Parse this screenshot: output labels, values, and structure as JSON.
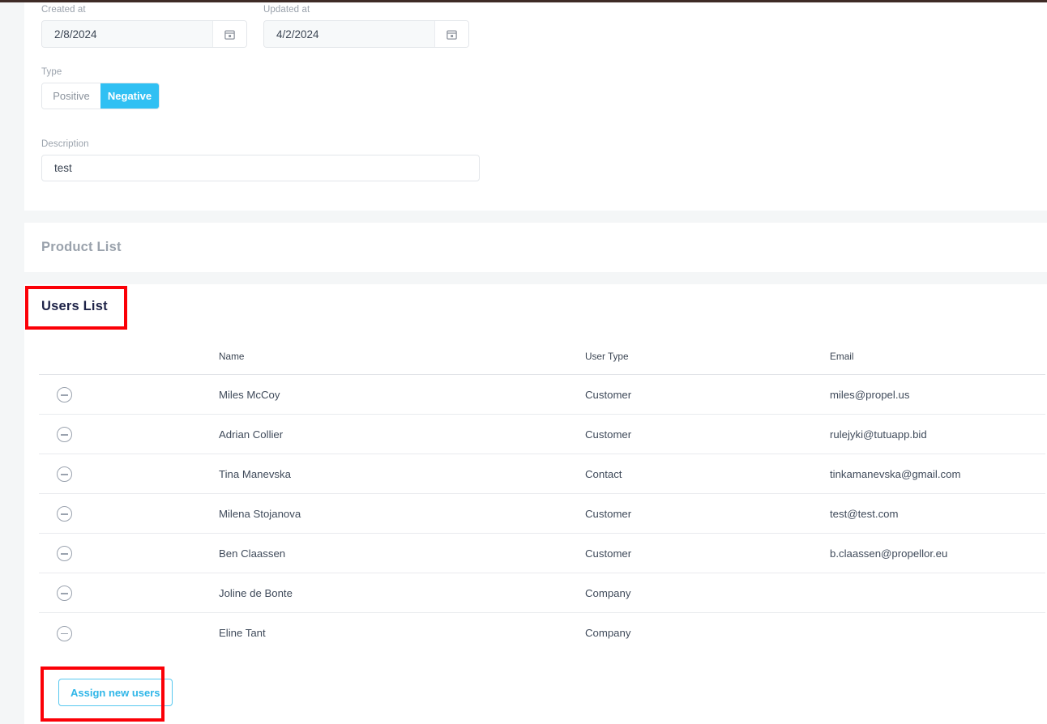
{
  "theme": {
    "accent": "#30c0f3",
    "accent_button_border": "#58c8ef",
    "highlight": "#fb0007",
    "page_bg": "#f4f6f7",
    "panel_bg": "#ffffff",
    "muted_text": "#9aa2ac",
    "title_text": "#1e2348"
  },
  "form": {
    "created_at": {
      "label": "Created at",
      "value": "2/8/2024",
      "icon": "calendar-icon"
    },
    "updated_at": {
      "label": "Updated at",
      "value": "4/2/2024",
      "icon": "calendar-icon"
    },
    "type": {
      "label": "Type",
      "options": [
        "Positive",
        "Negative"
      ],
      "selected": "Negative"
    },
    "description": {
      "label": "Description",
      "value": "test",
      "placeholder": ""
    }
  },
  "product_section": {
    "title": "Product List"
  },
  "users_section": {
    "title": "Users List",
    "columns": [
      "",
      "Name",
      "User Type",
      "Email"
    ],
    "rows": [
      {
        "remove_icon": "remove-circle-icon",
        "name": "Miles McCoy",
        "user_type": "Customer",
        "email": "miles@propel.us"
      },
      {
        "remove_icon": "remove-circle-icon",
        "name": "Adrian Collier",
        "user_type": "Customer",
        "email": "rulejyki@tutuapp.bid"
      },
      {
        "remove_icon": "remove-circle-icon",
        "name": "Tina Manevska",
        "user_type": "Contact",
        "email": "tinkamanevska@gmail.com"
      },
      {
        "remove_icon": "remove-circle-icon",
        "name": "Milena Stojanova",
        "user_type": "Customer",
        "email": "test@test.com"
      },
      {
        "remove_icon": "remove-circle-icon",
        "name": "Ben Claassen",
        "user_type": "Customer",
        "email": "b.claassen@propellor.eu"
      },
      {
        "remove_icon": "remove-circle-icon",
        "name": "Joline de Bonte",
        "user_type": "Company",
        "email": ""
      },
      {
        "remove_icon": "remove-circle-icon",
        "name": "Eline Tant",
        "user_type": "Company",
        "email": ""
      }
    ],
    "assign_button_label": "Assign new users"
  }
}
